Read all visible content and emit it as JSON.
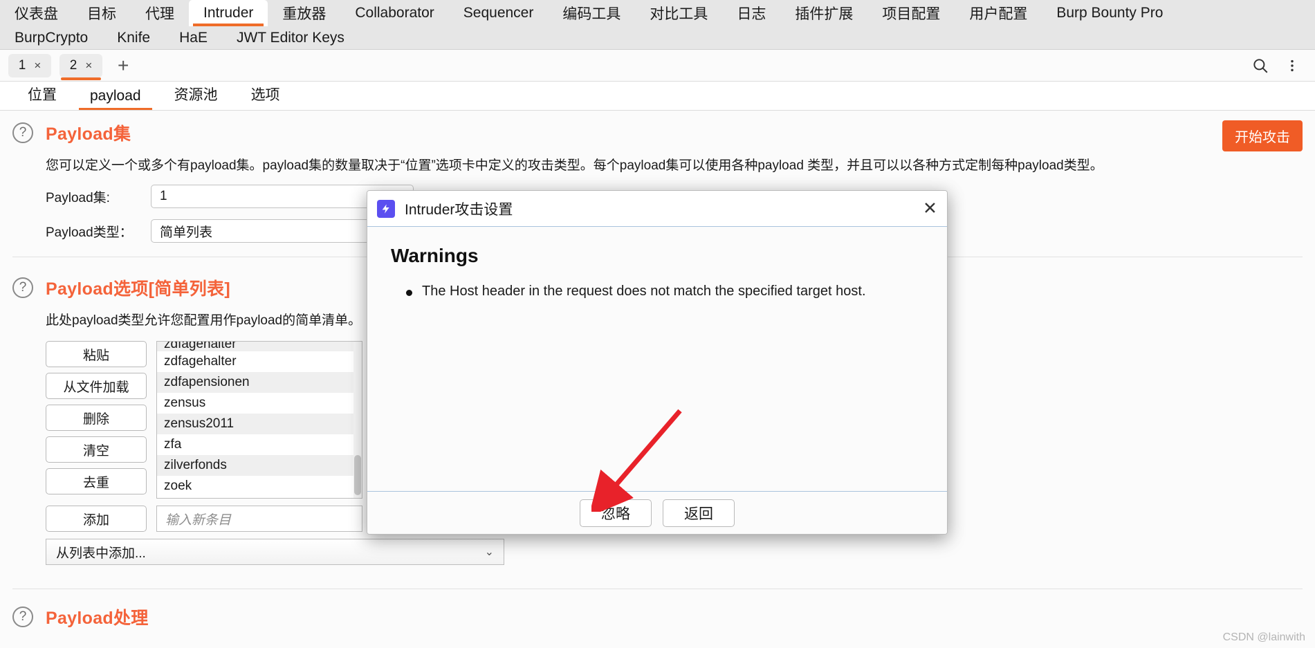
{
  "topbar": {
    "row1": [
      {
        "label": "仪表盘",
        "active": false
      },
      {
        "label": "目标",
        "active": false
      },
      {
        "label": "代理",
        "active": false
      },
      {
        "label": "Intruder",
        "active": true
      },
      {
        "label": "重放器",
        "active": false
      },
      {
        "label": "Collaborator",
        "active": false
      },
      {
        "label": "Sequencer",
        "active": false
      },
      {
        "label": "编码工具",
        "active": false
      },
      {
        "label": "对比工具",
        "active": false
      },
      {
        "label": "日志",
        "active": false
      },
      {
        "label": "插件扩展",
        "active": false
      },
      {
        "label": "项目配置",
        "active": false
      },
      {
        "label": "用户配置",
        "active": false
      },
      {
        "label": "Burp Bounty Pro",
        "active": false
      }
    ],
    "row2": [
      "BurpCrypto",
      "Knife",
      "HaE",
      "JWT Editor Keys"
    ]
  },
  "tabstrip": {
    "tabs": [
      {
        "label": "1",
        "close": "×",
        "active": false
      },
      {
        "label": "2",
        "close": "×",
        "active": true
      }
    ],
    "add_label": "+",
    "search_icon": "search-icon",
    "more_icon": "more-vertical-icon"
  },
  "subtabs": [
    {
      "label": "位置",
      "active": false
    },
    {
      "label": "payload",
      "active": true
    },
    {
      "label": "资源池",
      "active": false
    },
    {
      "label": "选项",
      "active": false
    }
  ],
  "payload_set": {
    "help": "?",
    "title": "Payload集",
    "description": "您可以定义一个或多个有payload集。payload集的数量取决于“位置”选项卡中定义的攻击类型。每个payload集可以使用各种payload 类型，并且可以以各种方式定制每种payload类型。",
    "start_attack": "开始攻击",
    "set_label": "Payload集:",
    "set_value": "1",
    "type_label": "Payload类型：",
    "type_value": "简单列表"
  },
  "payload_options": {
    "help": "?",
    "title": "Payload选项[简单列表]",
    "description": "此处payload类型允许您配置用作payload的简单清单。",
    "buttons": [
      "粘贴",
      "从文件加载",
      "删除",
      "清空",
      "去重"
    ],
    "add_button": "添加",
    "add_placeholder": "输入新条目",
    "from_list_label": "从列表中添加...",
    "from_list_chevron": "⌄",
    "list_items": [
      "zdfagehalter",
      "zdfagehalter",
      "zdfapensionen",
      "zensus",
      "zensus2011",
      "zfa",
      "zilverfonds",
      "zoek"
    ]
  },
  "payload_processing": {
    "help": "?",
    "title": "Payload处理"
  },
  "dialog": {
    "icon": "bolt-icon",
    "icon_glyph": "⚡",
    "title": "Intruder攻击设置",
    "close": "✕",
    "heading": "Warnings",
    "warnings": [
      "The Host header in the request does not match the specified target host."
    ],
    "buttons": [
      {
        "label": "忽略",
        "name": "ignore-button"
      },
      {
        "label": "返回",
        "name": "back-button"
      }
    ]
  },
  "watermark": "CSDN @lainwith",
  "colors": {
    "accent": "#ef6c29",
    "section_title": "#f4633a",
    "start_attack_bg": "#f05c26",
    "dialog_icon": "#5b4ff0",
    "annotation_arrow": "#e8222a"
  }
}
